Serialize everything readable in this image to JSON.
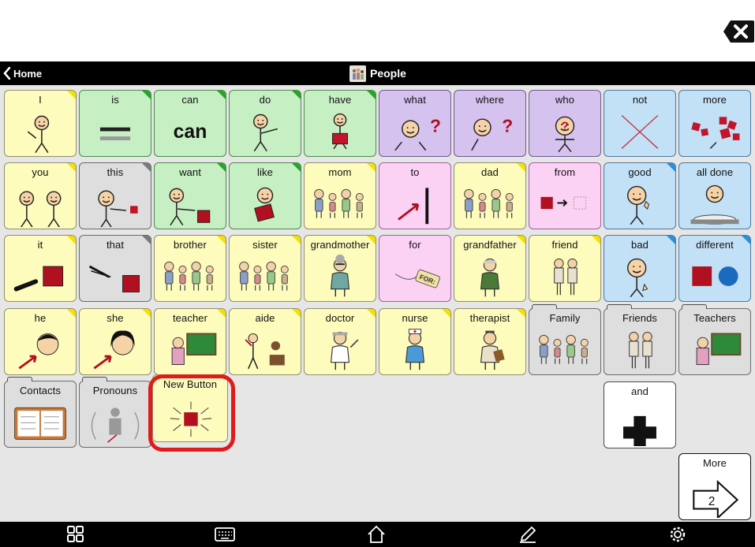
{
  "header": {
    "home_label": "Home",
    "title": "People"
  },
  "toolbar_icons": [
    "clear-icon"
  ],
  "colors": {
    "accent_highlight": "#e01b1b",
    "yellow": "#fdfcbc",
    "green": "#c6efc4",
    "purple": "#d5c2ef",
    "blue": "#c2e0f6",
    "pink": "#fbd1f4",
    "gray": "#dedede"
  },
  "cells": [
    {
      "label": "I",
      "color": "y",
      "corner": "#f5e000",
      "icon": "me-pointing-icon"
    },
    {
      "label": "is",
      "color": "g",
      "corner": "#27a527",
      "icon": "equals-icon"
    },
    {
      "label": "can",
      "color": "g",
      "corner": "#27a527",
      "icon": "can-text-icon",
      "big_text": "can"
    },
    {
      "label": "do",
      "color": "g",
      "corner": "#27a527",
      "icon": "do-action-icon"
    },
    {
      "label": "have",
      "color": "g",
      "corner": "#27a527",
      "icon": "have-holding-icon"
    },
    {
      "label": "what",
      "color": "p",
      "corner": "",
      "icon": "what-question-icon"
    },
    {
      "label": "where",
      "color": "p",
      "corner": "",
      "icon": "where-question-icon"
    },
    {
      "label": "who",
      "color": "p",
      "corner": "",
      "icon": "who-question-icon"
    },
    {
      "label": "not",
      "color": "b",
      "corner": "",
      "icon": "red-x-icon"
    },
    {
      "label": "more",
      "color": "b",
      "corner": "",
      "icon": "more-squares-icon"
    },
    {
      "label": "you",
      "color": "y",
      "corner": "#f5e000",
      "icon": "you-pointing-icon"
    },
    {
      "label": "this",
      "color": "gr",
      "corner": "#7a7a7a",
      "icon": "this-pointing-icon"
    },
    {
      "label": "want",
      "color": "g",
      "corner": "#27a527",
      "icon": "want-reaching-icon"
    },
    {
      "label": "like",
      "color": "g",
      "corner": "#27a527",
      "icon": "like-hugging-icon"
    },
    {
      "label": "mom",
      "color": "y",
      "corner": "#f5e000",
      "icon": "family-mom-icon"
    },
    {
      "label": "to",
      "color": "pk",
      "corner": "",
      "icon": "to-arrow-icon"
    },
    {
      "label": "dad",
      "color": "y",
      "corner": "#f5e000",
      "icon": "family-dad-icon"
    },
    {
      "label": "from",
      "color": "pk",
      "corner": "",
      "icon": "from-arrow-icon"
    },
    {
      "label": "good",
      "color": "b",
      "corner": "#2c8fd8",
      "icon": "thumbs-up-icon"
    },
    {
      "label": "all done",
      "color": "b",
      "corner": "",
      "icon": "all-done-plate-icon"
    },
    {
      "label": "it",
      "color": "y",
      "corner": "#f5e000",
      "icon": "it-pointing-icon"
    },
    {
      "label": "that",
      "color": "gr",
      "corner": "#7a7a7a",
      "icon": "that-pointing-icon"
    },
    {
      "label": "brother",
      "color": "y",
      "corner": "#f5e000",
      "icon": "family-brother-icon"
    },
    {
      "label": "sister",
      "color": "y",
      "corner": "#f5e000",
      "icon": "family-sister-icon"
    },
    {
      "label": "grandmother",
      "color": "y",
      "corner": "#f5e000",
      "icon": "grandmother-icon"
    },
    {
      "label": "for",
      "color": "pk",
      "corner": "",
      "icon": "for-tag-icon",
      "tag_text": "FOR:"
    },
    {
      "label": "grandfather",
      "color": "y",
      "corner": "#f5e000",
      "icon": "grandfather-icon"
    },
    {
      "label": "friend",
      "color": "y",
      "corner": "#f5e000",
      "icon": "friend-icon"
    },
    {
      "label": "bad",
      "color": "b",
      "corner": "#2c8fd8",
      "icon": "thumbs-down-icon"
    },
    {
      "label": "different",
      "color": "b",
      "corner": "#2c8fd8",
      "icon": "different-shapes-icon"
    },
    {
      "label": "he",
      "color": "y",
      "corner": "#f5e000",
      "icon": "he-boy-icon"
    },
    {
      "label": "she",
      "color": "y",
      "corner": "#f5e000",
      "icon": "she-girl-icon"
    },
    {
      "label": "teacher",
      "color": "y",
      "corner": "#f5e000",
      "icon": "teacher-icon"
    },
    {
      "label": "aide",
      "color": "y",
      "corner": "#f5e000",
      "icon": "aide-icon"
    },
    {
      "label": "doctor",
      "color": "y",
      "corner": "#f5e000",
      "icon": "doctor-icon"
    },
    {
      "label": "nurse",
      "color": "y",
      "corner": "#f5e000",
      "icon": "nurse-icon"
    },
    {
      "label": "therapist",
      "color": "y",
      "corner": "#f5e000",
      "icon": "therapist-icon"
    },
    {
      "label": "Family",
      "color": "gr",
      "corner": "",
      "folder": true,
      "icon": "family-folder-icon"
    },
    {
      "label": "Friends",
      "color": "gr",
      "corner": "",
      "folder": true,
      "icon": "friends-folder-icon"
    },
    {
      "label": "Teachers",
      "color": "gr",
      "corner": "",
      "folder": true,
      "icon": "teachers-folder-icon"
    },
    {
      "label": "Contacts",
      "color": "gr",
      "corner": "",
      "folder": true,
      "icon": "contacts-book-icon"
    },
    {
      "label": "Pronouns",
      "color": "gr",
      "corner": "",
      "folder": true,
      "icon": "pronouns-icon"
    },
    {
      "label": "New Button",
      "color": "y",
      "corner": "",
      "icon": "new-button-burst-icon"
    },
    {
      "label": "and",
      "color": "w",
      "corner": "",
      "icon": "plus-icon"
    },
    {
      "label": "More",
      "color": "w",
      "corner": "",
      "icon": "more-arrow-icon",
      "page_number": "2"
    }
  ],
  "bottom_bar": [
    {
      "name": "apps-grid-icon"
    },
    {
      "name": "keyboard-icon"
    },
    {
      "name": "home-icon"
    },
    {
      "name": "pencil-edit-icon"
    },
    {
      "name": "settings-gear-icon"
    }
  ]
}
